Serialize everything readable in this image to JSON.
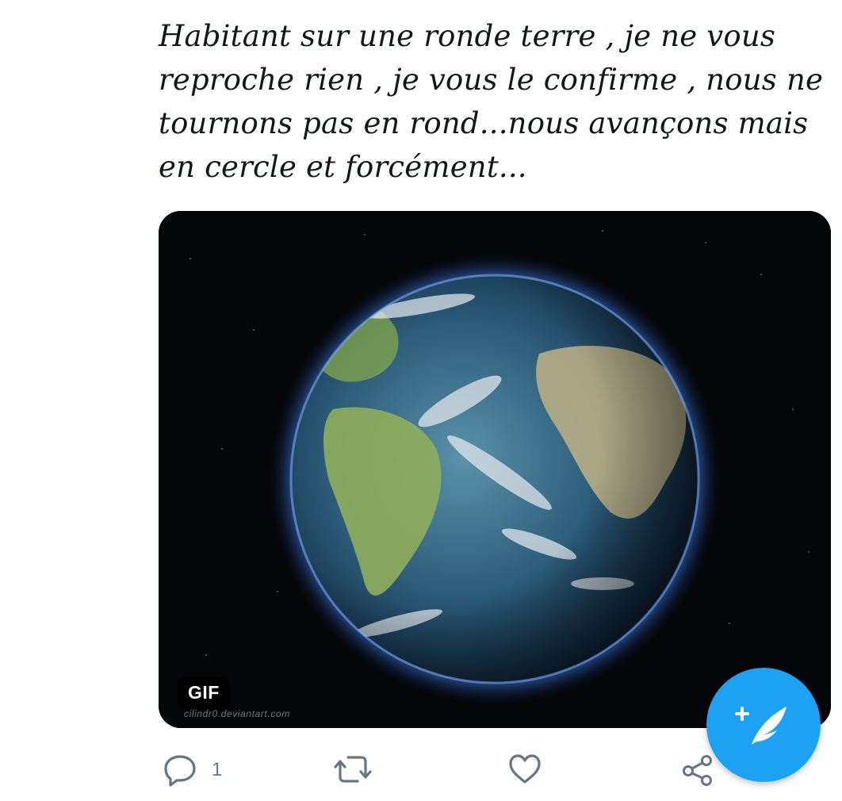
{
  "tweet": {
    "text": "Habitant sur une ronde terre , je ne vous reproche rien , je vous le confirme , nous ne tournons pas en rond...nous avançons mais en cercle et forcément...",
    "media": {
      "badge": "GIF",
      "watermark": "cilindr0.deviantart.com",
      "icon": "earth-globe-gif"
    }
  },
  "actions": {
    "reply": {
      "icon": "reply-icon",
      "count": "1"
    },
    "retweet": {
      "icon": "retweet-icon"
    },
    "like": {
      "icon": "heart-icon"
    },
    "share": {
      "icon": "share-icon"
    }
  },
  "compose_fab": {
    "icon": "compose-tweet-icon"
  },
  "colors": {
    "accent": "#1da1f2",
    "action_gray": "#657786",
    "text": "#14171a"
  }
}
